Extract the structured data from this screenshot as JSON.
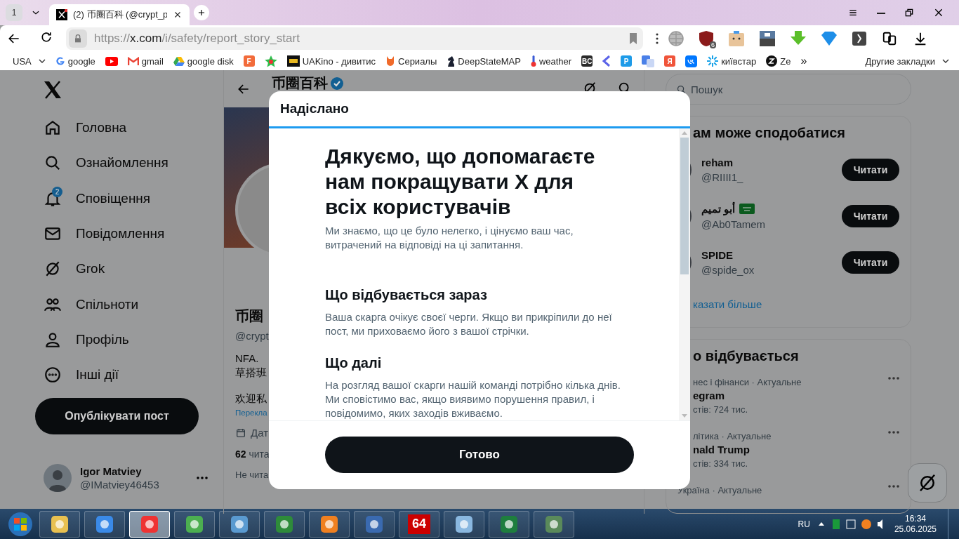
{
  "browser": {
    "tab_counter": "1",
    "tabs": [
      {
        "title": "(2) 币圈百科 (@crypt_p",
        "selected": true
      }
    ],
    "url": {
      "scheme": "https://",
      "host": "x.com",
      "path": "/i/safety/report_story_start"
    },
    "extension_badge": "6",
    "bookmarks": [
      {
        "kind": "folder",
        "label": "USA"
      },
      {
        "kind": "link",
        "label": "google"
      },
      {
        "kind": "icon"
      },
      {
        "kind": "link",
        "label": "gmail"
      },
      {
        "kind": "link",
        "label": "google disk"
      },
      {
        "kind": "logo",
        "label": "F",
        "color": "#f26b3a"
      },
      {
        "kind": "icon"
      },
      {
        "kind": "link",
        "label": "UAKino - дивитис"
      },
      {
        "kind": "link",
        "label": "Сериалы"
      },
      {
        "kind": "link",
        "label": "DeepStateMAP"
      },
      {
        "kind": "link",
        "label": "weather"
      },
      {
        "kind": "logo",
        "label": "BC",
        "color": "#2b2b2b"
      },
      {
        "kind": "icon"
      },
      {
        "kind": "logo",
        "label": "P",
        "color": "#1e9be8"
      },
      {
        "kind": "icon"
      },
      {
        "kind": "logo",
        "label": "Я",
        "color": "#f0543a"
      },
      {
        "kind": "icon"
      },
      {
        "kind": "link",
        "label": "київстар"
      },
      {
        "kind": "link",
        "label": "Ze"
      },
      {
        "kind": "more",
        "label": "»"
      },
      {
        "kind": "folder",
        "label": "Другие закладки"
      }
    ]
  },
  "sidebar": {
    "nav": [
      {
        "label": "Головна"
      },
      {
        "label": "Ознайомлення"
      },
      {
        "label": "Сповіщення",
        "badge": "2"
      },
      {
        "label": "Повідомлення"
      },
      {
        "label": "Grok"
      },
      {
        "label": "Спільноти"
      },
      {
        "label": "Профіль"
      },
      {
        "label": "Інші дії"
      }
    ],
    "post_button": "Опублікувати пост",
    "account": {
      "name": "Igor Matviey",
      "handle": "@IMatviey46453"
    }
  },
  "profile": {
    "title": "币圈百科",
    "name": "币圈",
    "handle": "@crypt",
    "bio": [
      "NFA.",
      "草搭班"
    ],
    "bio_2": "欢迎私",
    "translate_link": "Перекла",
    "joined": "Дат",
    "following_count": "62",
    "following_label": "чита",
    "followed_by": "Не чита"
  },
  "modal": {
    "header": "Надіслано",
    "title": "Дякуємо, що допомагаєте нам покращувати X для всіх користувачів",
    "intro": "Ми знаємо, що це було нелегко, і цінуємо ваш час, витрачений на відповіді на ці запитання.",
    "sections": [
      {
        "heading": "Що відбувається зараз",
        "body": "Ваша скарга очікує своєї черги. Якщо ви прикріпили до неї пост, ми приховаємо його з вашої стрічки."
      },
      {
        "heading": "Що далі",
        "body": "На розгляд вашої скарги нашій команді потрібно кілька днів. Ми сповістимо вас, якщо виявимо порушення правил, і повідомимо, яких заходів вживаємо."
      }
    ],
    "button": "Готово"
  },
  "right": {
    "search_placeholder": "Пошук",
    "who_to_follow": {
      "title": "ам може сподобатися",
      "accounts": [
        {
          "name": "reham",
          "handle": "@RIIII1_",
          "button": "Читати",
          "flag": false
        },
        {
          "name": "أبو تميم",
          "handle": "@Ab0Tamem",
          "button": "Читати",
          "flag": true
        },
        {
          "name": "SPIDE",
          "handle": "@spide_ox",
          "button": "Читати",
          "flag": false
        }
      ],
      "show_more": "казати більше"
    },
    "trends": {
      "title": "о відбувається",
      "items": [
        {
          "meta": "нес і фінанси · Актуальне",
          "name": "egram",
          "count": "стів: 724 тис."
        },
        {
          "meta": "літика · Актуальне",
          "name": "nald Trump",
          "count": "стів: 334 тис."
        },
        {
          "meta": "Україна · Актуальне"
        }
      ]
    }
  },
  "taskbar": {
    "apps": [
      {
        "selected": false
      },
      {
        "selected": false
      },
      {
        "selected": true
      },
      {
        "selected": false
      },
      {
        "selected": false
      },
      {
        "selected": false
      },
      {
        "selected": false
      },
      {
        "selected": false
      },
      {
        "selected": false,
        "label": "64"
      },
      {
        "selected": false
      },
      {
        "selected": false
      },
      {
        "selected": false
      }
    ],
    "language": "RU",
    "time": "16:34",
    "date": "25.06.2025"
  }
}
